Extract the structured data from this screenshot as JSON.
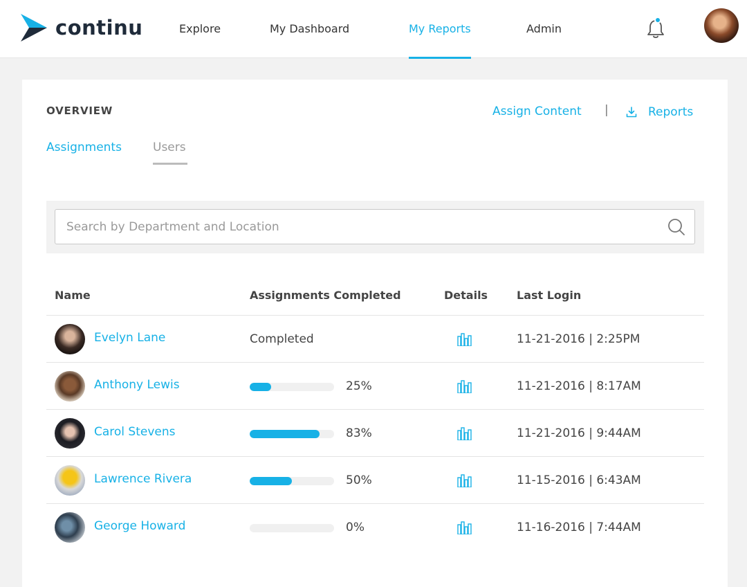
{
  "header": {
    "logo_text": "continu",
    "nav": [
      {
        "label": "Explore",
        "active": false
      },
      {
        "label": "My Dashboard",
        "active": false
      },
      {
        "label": "My Reports",
        "active": true
      },
      {
        "label": "Admin",
        "active": false
      }
    ],
    "icons": {
      "notifications": "bell-icon",
      "profile": "avatar"
    }
  },
  "overview": {
    "title": "OVERVIEW",
    "assign_content_label": "Assign Content",
    "separator": "|",
    "reports_label": "Reports"
  },
  "tabs": [
    {
      "label": "Assignments",
      "active": false
    },
    {
      "label": "Users",
      "active": true
    }
  ],
  "search": {
    "placeholder": "Search by Department and Location",
    "value": ""
  },
  "table": {
    "columns": [
      "Name",
      "Assignments Completed",
      "Details",
      "Last Login"
    ],
    "rows": [
      {
        "name": "Evelyn Lane",
        "completed_text": "Completed",
        "progress": null,
        "pct_label": "",
        "last_login": "11-21-2016 | 2:25PM"
      },
      {
        "name": "Anthony Lewis",
        "completed_text": "",
        "progress": 25,
        "pct_label": "25%",
        "last_login": "11-21-2016 | 8:17AM"
      },
      {
        "name": "Carol Stevens",
        "completed_text": "",
        "progress": 83,
        "pct_label": "83%",
        "last_login": "11-21-2016 | 9:44AM"
      },
      {
        "name": "Lawrence Rivera",
        "completed_text": "",
        "progress": 50,
        "pct_label": "50%",
        "last_login": "11-15-2016 | 6:43AM"
      },
      {
        "name": "George Howard",
        "completed_text": "",
        "progress": 0,
        "pct_label": "0%",
        "last_login": "11-16-2016 | 7:44AM"
      }
    ]
  },
  "colors": {
    "accent": "#17b1e6",
    "text": "#444444",
    "background": "#f2f2f2"
  }
}
